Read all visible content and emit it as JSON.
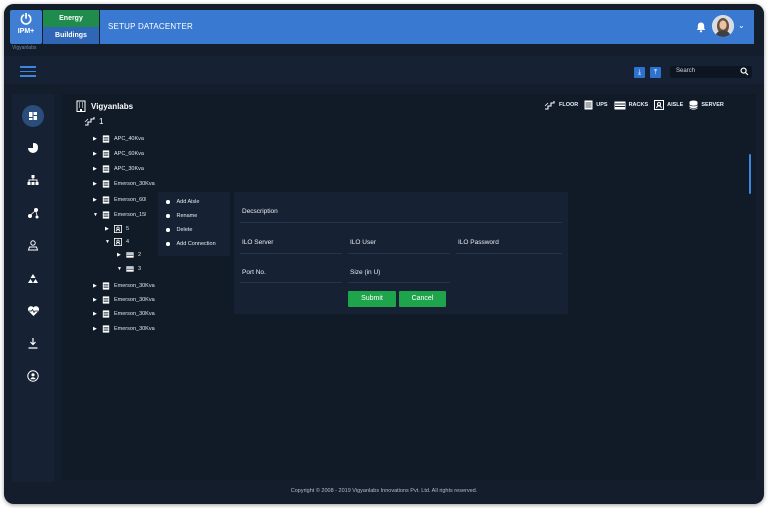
{
  "brand": {
    "product": "IPM+",
    "sub": "Vigyanlabs",
    "tag_primary": "Energy Assistant",
    "tag_secondary": "Buildings"
  },
  "header": {
    "title": "SETUP DATACENTER"
  },
  "toolbar": {
    "search_placeholder": "Search"
  },
  "org": {
    "name": "Vigyanlabs",
    "floor_label": "1"
  },
  "legend": [
    "FLOOR",
    "UPS",
    "RACKS",
    "AISLE",
    "SERVER"
  ],
  "tree": {
    "nodes": [
      "APC_40Kva",
      "APC_60Kva",
      "APC_30Kva",
      "Emerson_30Kva",
      "Emerson_60Kva",
      "Emerson_15Kva",
      "5",
      "4",
      "2",
      "3",
      "Emerson_30Kva",
      "Emerson_30Kva",
      "Emerson_30Kva",
      "Emerson_30Kva"
    ]
  },
  "context_menu": [
    "Add Aisle",
    "Rename",
    "Delete",
    "Add Connection"
  ],
  "form": {
    "description_label": "Decscription",
    "ilo_server_label": "ILO Server",
    "ilo_user_label": "ILO User",
    "ilo_password_label": "ILO Password",
    "port_label": "Port No.",
    "size_label": "Size (in U)",
    "submit_label": "Submit",
    "cancel_label": "Cancel"
  },
  "footer": {
    "copyright": "Copyright © 2008 - 2019  Vigyanlabs Innovations Pvt. Ltd. All rights reserved."
  },
  "colors": {
    "accent": "#3a79d1",
    "success": "#1ea44b",
    "background": "#131d2b"
  }
}
